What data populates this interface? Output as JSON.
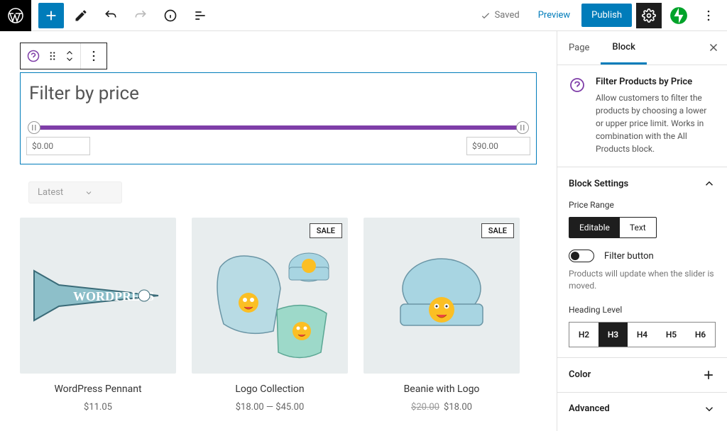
{
  "topbar": {
    "saved_label": "Saved",
    "preview_label": "Preview",
    "publish_label": "Publish"
  },
  "filter_block": {
    "title": "Filter by price",
    "min_price": "$0.00",
    "max_price": "$90.00"
  },
  "sort": {
    "selected": "Latest"
  },
  "products": [
    {
      "name": "WordPress Pennant",
      "price": "$11.05",
      "sale": false
    },
    {
      "name": "Logo Collection",
      "price": "$18.00 — $45.00",
      "sale": true,
      "sale_label": "SALE"
    },
    {
      "name": "Beanie with Logo",
      "price": "$18.00",
      "original": "$20.00",
      "sale": true,
      "sale_label": "SALE"
    }
  ],
  "sidebar": {
    "tab_page": "Page",
    "tab_block": "Block",
    "block_title": "Filter Products by Price",
    "block_desc": "Allow customers to filter the products by choosing a lower or upper price limit. Works in combination with the All Products block.",
    "settings_title": "Block Settings",
    "price_range_label": "Price Range",
    "editable_opt": "Editable",
    "text_opt": "Text",
    "filter_button_label": "Filter button",
    "filter_button_desc": "Products will update when the slider is moved.",
    "heading_level_label": "Heading Level",
    "heading_options": [
      "H2",
      "H3",
      "H4",
      "H5",
      "H6"
    ],
    "color_title": "Color",
    "advanced_title": "Advanced"
  }
}
